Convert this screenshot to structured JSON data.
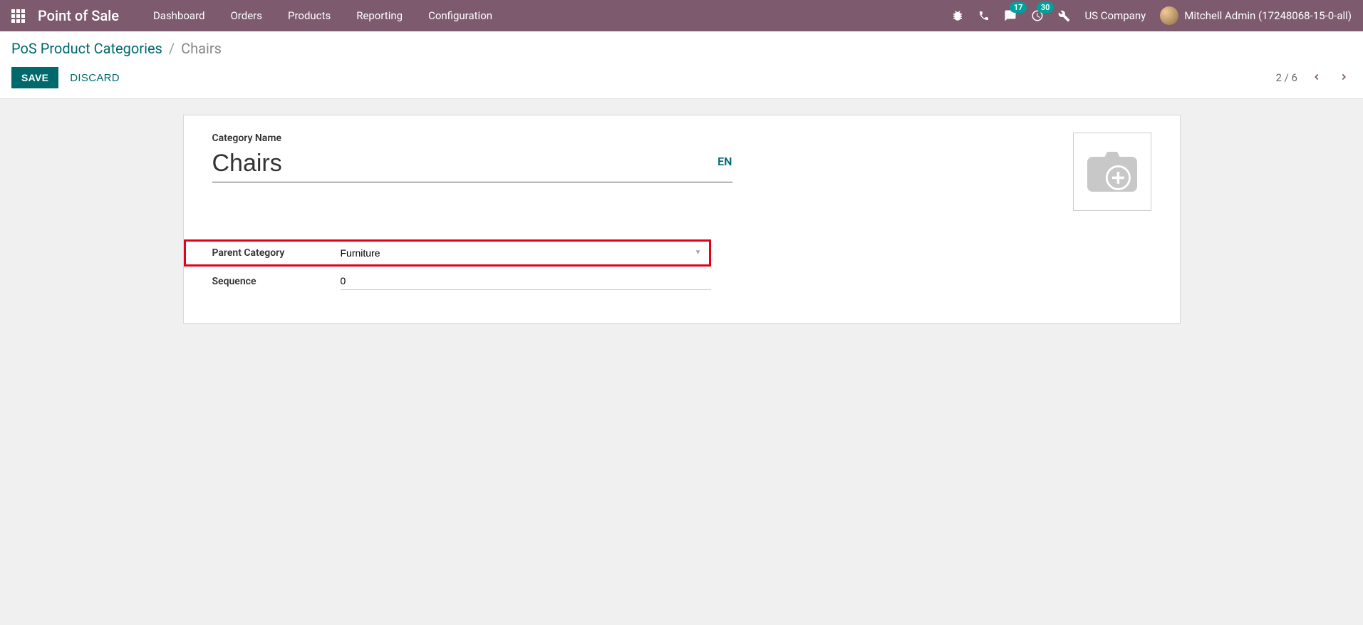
{
  "navbar": {
    "app_title": "Point of Sale",
    "menu": [
      "Dashboard",
      "Orders",
      "Products",
      "Reporting",
      "Configuration"
    ],
    "messaging_badge": "17",
    "activities_badge": "30",
    "company": "US Company",
    "user": "Mitchell Admin (17248068-15-0-all)"
  },
  "breadcrumb": {
    "parent": "PoS Product Categories",
    "current": "Chairs"
  },
  "buttons": {
    "save": "SAVE",
    "discard": "DISCARD"
  },
  "pager": {
    "value": "2 / 6"
  },
  "form": {
    "category_name_label": "Category Name",
    "category_name_value": "Chairs",
    "lang": "EN",
    "parent_category_label": "Parent Category",
    "parent_category_value": "Furniture",
    "sequence_label": "Sequence",
    "sequence_value": "0"
  }
}
